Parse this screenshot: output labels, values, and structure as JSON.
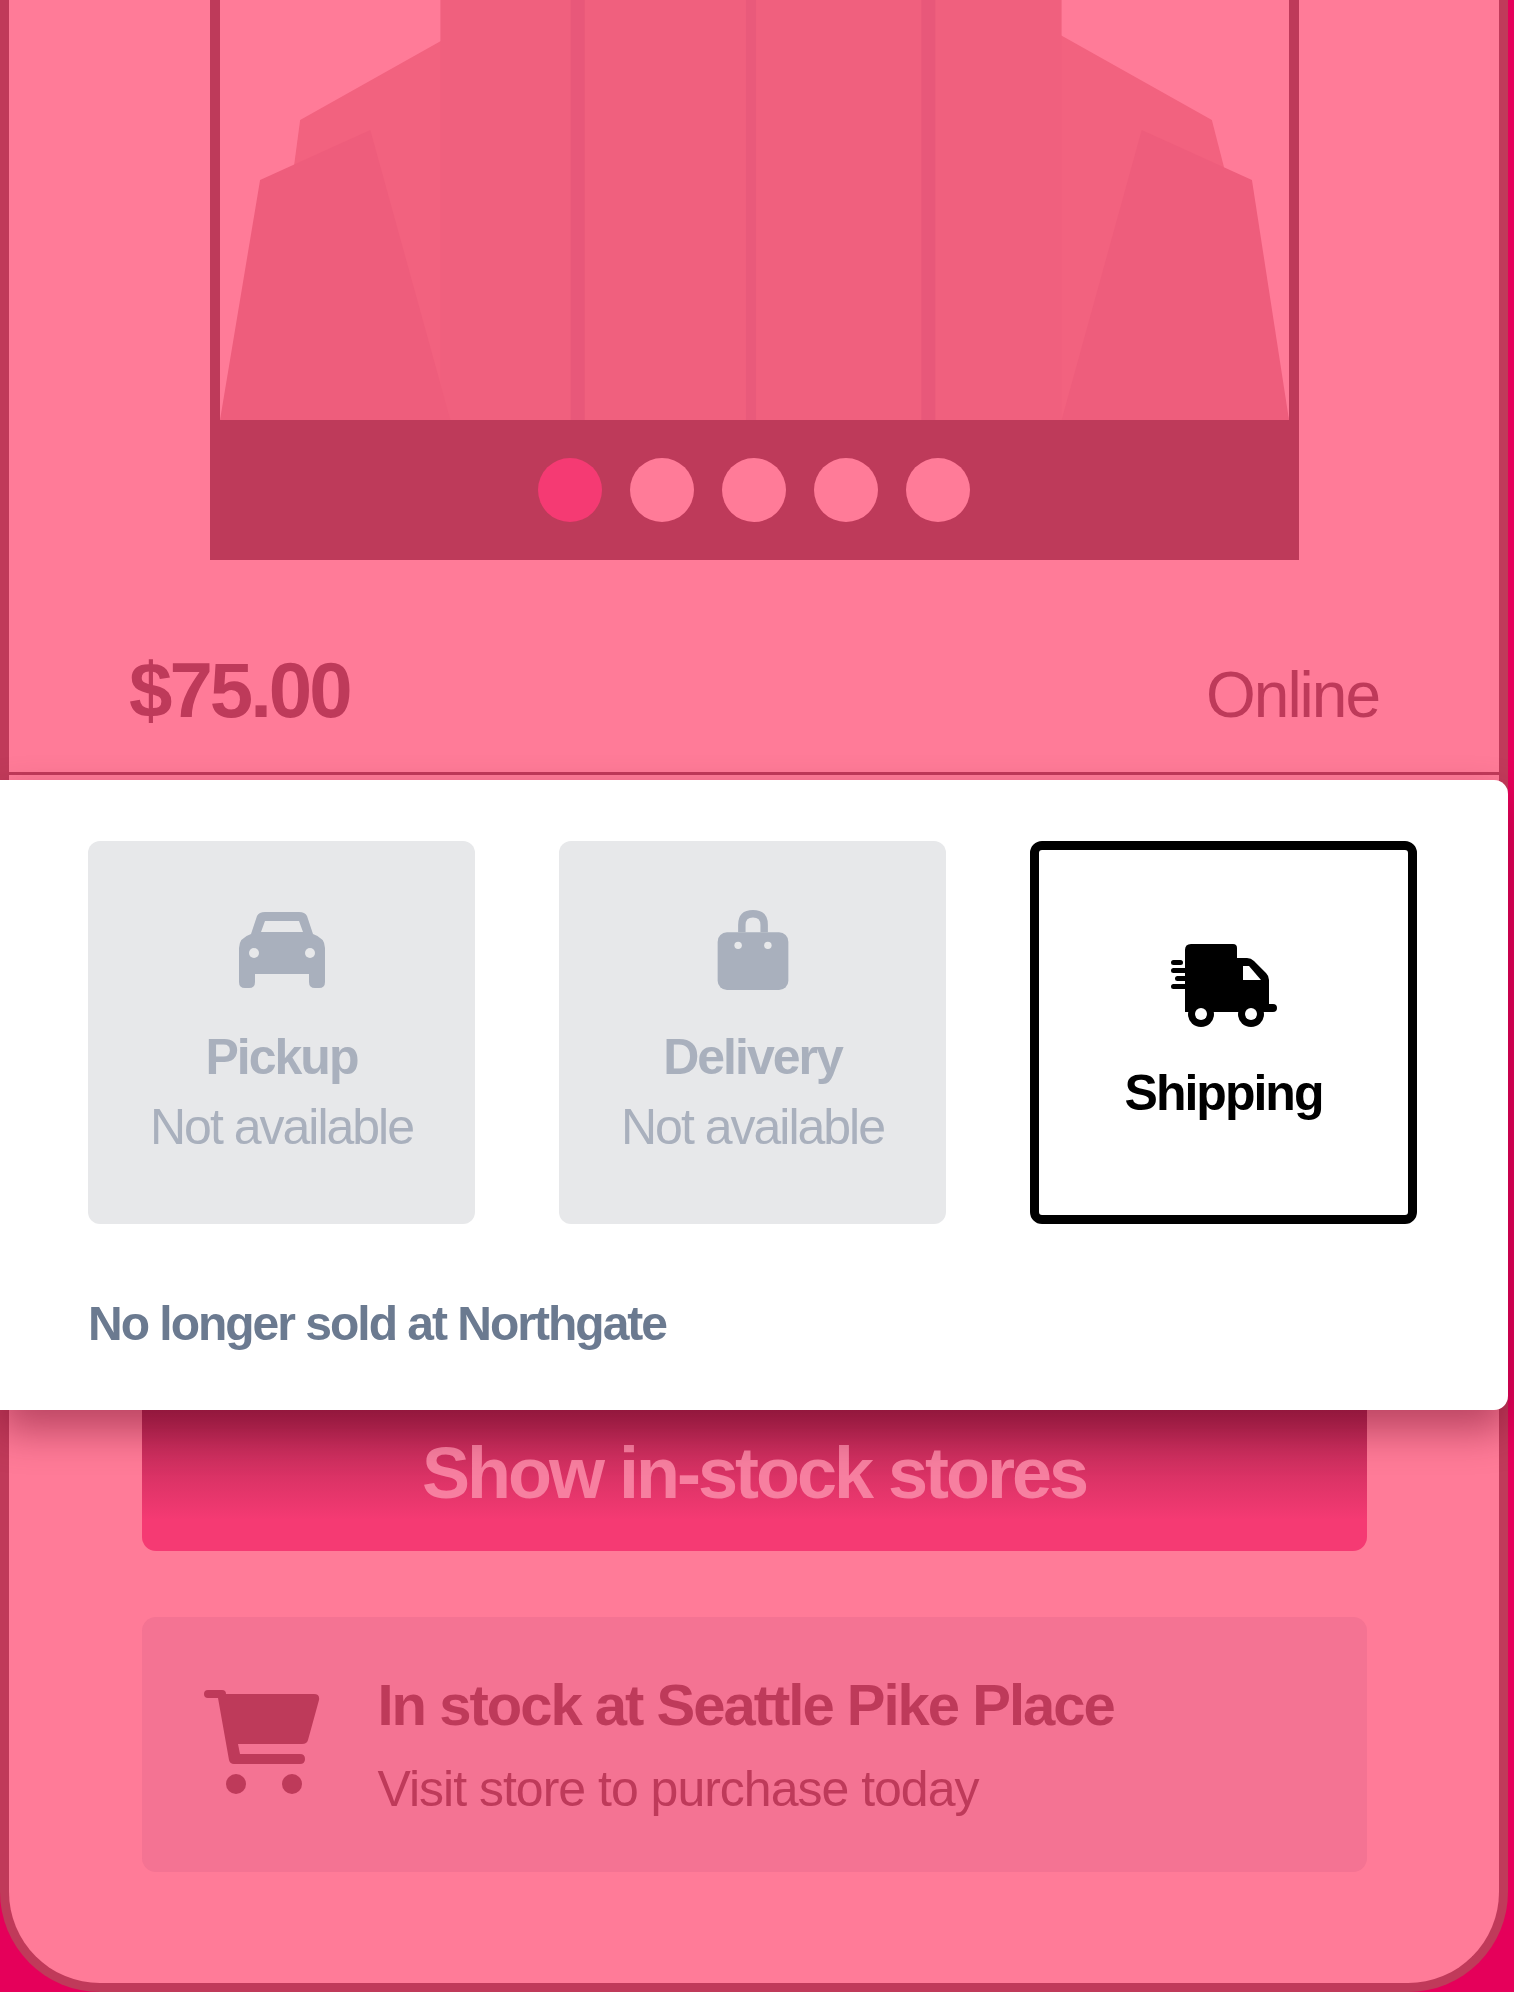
{
  "product": {
    "carousel_dots": [
      {
        "selected": true
      },
      {
        "selected": false
      },
      {
        "selected": false
      },
      {
        "selected": false
      },
      {
        "selected": false
      }
    ],
    "price": "$75.00",
    "availability": "Online"
  },
  "fulfillment_sheet": {
    "options": [
      {
        "kind": "pickup",
        "label": "Pickup",
        "status": "Not available",
        "available": false,
        "selected": false
      },
      {
        "kind": "delivery",
        "label": "Delivery",
        "status": "Not available",
        "available": false,
        "selected": false
      },
      {
        "kind": "shipping",
        "label": "Shipping",
        "available": true,
        "selected": true
      }
    ],
    "note": "No longer sold at Northgate"
  },
  "stock_button": "Show in-stock stores",
  "store_card": {
    "title": "In stock at Seattle Pike Place",
    "subtitle": "Visit store to purchase today"
  }
}
